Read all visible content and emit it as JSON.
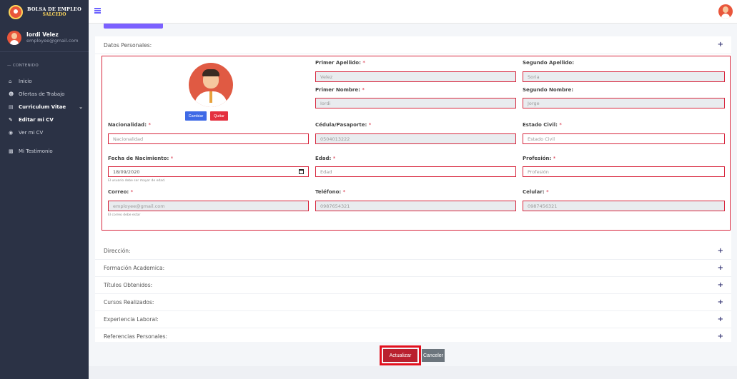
{
  "brand": {
    "line1": "BOLSA DE EMPLEO",
    "line2": "SALCEDO"
  },
  "user": {
    "name": "Iordi Velez",
    "email": "employee@gmail.com"
  },
  "sidebar": {
    "section": "— CONTENIDO",
    "items": [
      {
        "label": "Inicio",
        "icon": "home-icon"
      },
      {
        "label": "Ofertas de Trabajo",
        "icon": "user-icon"
      },
      {
        "label": "Curriculum Vitae",
        "icon": "document-icon"
      },
      {
        "label": "Editar mi CV",
        "icon": "pencil-icon"
      },
      {
        "label": "Ver mi CV",
        "icon": "eye-icon"
      },
      {
        "label": "Mi Testimonio",
        "icon": "comment-icon"
      }
    ]
  },
  "datos": {
    "title": "Datos Personales:",
    "photo_buttons": {
      "change": "Cambiar",
      "remove": "Quitar"
    },
    "fields": {
      "primer_apellido": {
        "label": "Primer Apellido:",
        "value": "Velez"
      },
      "segundo_apellido": {
        "label": "Segundo Apellido:",
        "value": "Soria"
      },
      "primer_nombre": {
        "label": "Primer Nombre:",
        "value": "Iordi"
      },
      "segundo_nombre": {
        "label": "Segundo Nombre:",
        "value": "Jorge"
      },
      "nacionalidad": {
        "label": "Nacionalidad:",
        "placeholder": "Nacionalidad"
      },
      "cedula": {
        "label": "Cédula/Pasaporte:",
        "value": "0504013222"
      },
      "estado_civil": {
        "label": "Estado Civil:",
        "placeholder": "Estado Civil"
      },
      "fecha_nacimiento": {
        "label": "Fecha de Nacimiento:",
        "value": "18/09/2020",
        "hint": "El usuario debe ser mayor de edad."
      },
      "edad": {
        "label": "Edad:",
        "placeholder": "Edad"
      },
      "profesion": {
        "label": "Profesión:",
        "placeholder": "Profesión"
      },
      "correo": {
        "label": "Correo:",
        "value": "employee@gmail.com",
        "hint": "El correo debe estar"
      },
      "telefono": {
        "label": "Teléfono:",
        "value": "0987654321"
      },
      "celular": {
        "label": "Celular:",
        "value": "0987456321"
      }
    }
  },
  "sections": [
    "Dirección:",
    "Formación Academica:",
    "Títulos Obtenidos:",
    "Cursos Realizados:",
    "Experiencia Laboral:",
    "Referencias Personales:"
  ],
  "actions": {
    "update": "Actualizar",
    "cancel": "Canceler"
  },
  "colors": {
    "sidebar": "#2b3245",
    "error_border": "#d7263d",
    "primary": "#7b61ff",
    "update": "#b9202e"
  }
}
